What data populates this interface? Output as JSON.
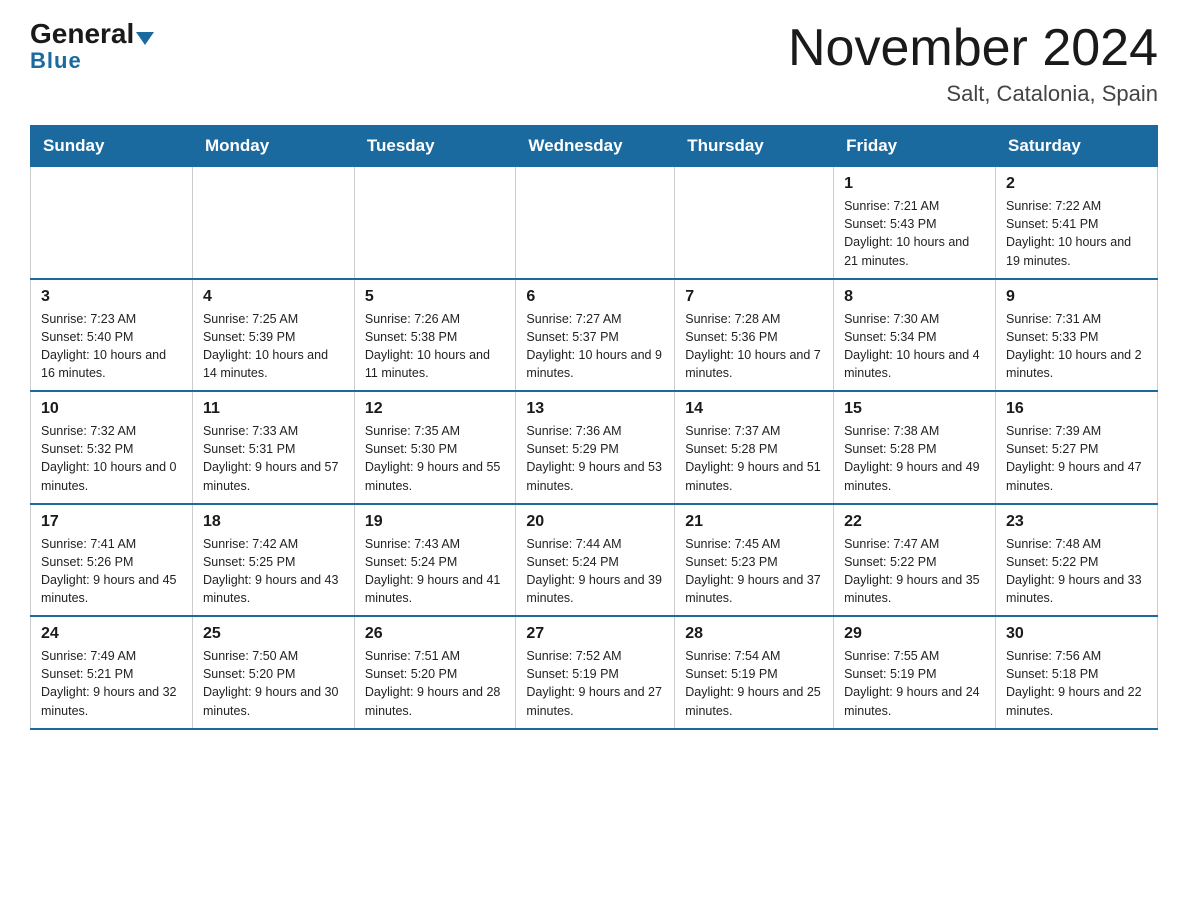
{
  "logo": {
    "general": "General",
    "blue": "Blue",
    "triangle": "▲"
  },
  "title": "November 2024",
  "subtitle": "Salt, Catalonia, Spain",
  "weekdays": [
    "Sunday",
    "Monday",
    "Tuesday",
    "Wednesday",
    "Thursday",
    "Friday",
    "Saturday"
  ],
  "weeks": [
    [
      {
        "day": "",
        "info": ""
      },
      {
        "day": "",
        "info": ""
      },
      {
        "day": "",
        "info": ""
      },
      {
        "day": "",
        "info": ""
      },
      {
        "day": "",
        "info": ""
      },
      {
        "day": "1",
        "info": "Sunrise: 7:21 AM\nSunset: 5:43 PM\nDaylight: 10 hours and 21 minutes."
      },
      {
        "day": "2",
        "info": "Sunrise: 7:22 AM\nSunset: 5:41 PM\nDaylight: 10 hours and 19 minutes."
      }
    ],
    [
      {
        "day": "3",
        "info": "Sunrise: 7:23 AM\nSunset: 5:40 PM\nDaylight: 10 hours and 16 minutes."
      },
      {
        "day": "4",
        "info": "Sunrise: 7:25 AM\nSunset: 5:39 PM\nDaylight: 10 hours and 14 minutes."
      },
      {
        "day": "5",
        "info": "Sunrise: 7:26 AM\nSunset: 5:38 PM\nDaylight: 10 hours and 11 minutes."
      },
      {
        "day": "6",
        "info": "Sunrise: 7:27 AM\nSunset: 5:37 PM\nDaylight: 10 hours and 9 minutes."
      },
      {
        "day": "7",
        "info": "Sunrise: 7:28 AM\nSunset: 5:36 PM\nDaylight: 10 hours and 7 minutes."
      },
      {
        "day": "8",
        "info": "Sunrise: 7:30 AM\nSunset: 5:34 PM\nDaylight: 10 hours and 4 minutes."
      },
      {
        "day": "9",
        "info": "Sunrise: 7:31 AM\nSunset: 5:33 PM\nDaylight: 10 hours and 2 minutes."
      }
    ],
    [
      {
        "day": "10",
        "info": "Sunrise: 7:32 AM\nSunset: 5:32 PM\nDaylight: 10 hours and 0 minutes."
      },
      {
        "day": "11",
        "info": "Sunrise: 7:33 AM\nSunset: 5:31 PM\nDaylight: 9 hours and 57 minutes."
      },
      {
        "day": "12",
        "info": "Sunrise: 7:35 AM\nSunset: 5:30 PM\nDaylight: 9 hours and 55 minutes."
      },
      {
        "day": "13",
        "info": "Sunrise: 7:36 AM\nSunset: 5:29 PM\nDaylight: 9 hours and 53 minutes."
      },
      {
        "day": "14",
        "info": "Sunrise: 7:37 AM\nSunset: 5:28 PM\nDaylight: 9 hours and 51 minutes."
      },
      {
        "day": "15",
        "info": "Sunrise: 7:38 AM\nSunset: 5:28 PM\nDaylight: 9 hours and 49 minutes."
      },
      {
        "day": "16",
        "info": "Sunrise: 7:39 AM\nSunset: 5:27 PM\nDaylight: 9 hours and 47 minutes."
      }
    ],
    [
      {
        "day": "17",
        "info": "Sunrise: 7:41 AM\nSunset: 5:26 PM\nDaylight: 9 hours and 45 minutes."
      },
      {
        "day": "18",
        "info": "Sunrise: 7:42 AM\nSunset: 5:25 PM\nDaylight: 9 hours and 43 minutes."
      },
      {
        "day": "19",
        "info": "Sunrise: 7:43 AM\nSunset: 5:24 PM\nDaylight: 9 hours and 41 minutes."
      },
      {
        "day": "20",
        "info": "Sunrise: 7:44 AM\nSunset: 5:24 PM\nDaylight: 9 hours and 39 minutes."
      },
      {
        "day": "21",
        "info": "Sunrise: 7:45 AM\nSunset: 5:23 PM\nDaylight: 9 hours and 37 minutes."
      },
      {
        "day": "22",
        "info": "Sunrise: 7:47 AM\nSunset: 5:22 PM\nDaylight: 9 hours and 35 minutes."
      },
      {
        "day": "23",
        "info": "Sunrise: 7:48 AM\nSunset: 5:22 PM\nDaylight: 9 hours and 33 minutes."
      }
    ],
    [
      {
        "day": "24",
        "info": "Sunrise: 7:49 AM\nSunset: 5:21 PM\nDaylight: 9 hours and 32 minutes."
      },
      {
        "day": "25",
        "info": "Sunrise: 7:50 AM\nSunset: 5:20 PM\nDaylight: 9 hours and 30 minutes."
      },
      {
        "day": "26",
        "info": "Sunrise: 7:51 AM\nSunset: 5:20 PM\nDaylight: 9 hours and 28 minutes."
      },
      {
        "day": "27",
        "info": "Sunrise: 7:52 AM\nSunset: 5:19 PM\nDaylight: 9 hours and 27 minutes."
      },
      {
        "day": "28",
        "info": "Sunrise: 7:54 AM\nSunset: 5:19 PM\nDaylight: 9 hours and 25 minutes."
      },
      {
        "day": "29",
        "info": "Sunrise: 7:55 AM\nSunset: 5:19 PM\nDaylight: 9 hours and 24 minutes."
      },
      {
        "day": "30",
        "info": "Sunrise: 7:56 AM\nSunset: 5:18 PM\nDaylight: 9 hours and 22 minutes."
      }
    ]
  ]
}
